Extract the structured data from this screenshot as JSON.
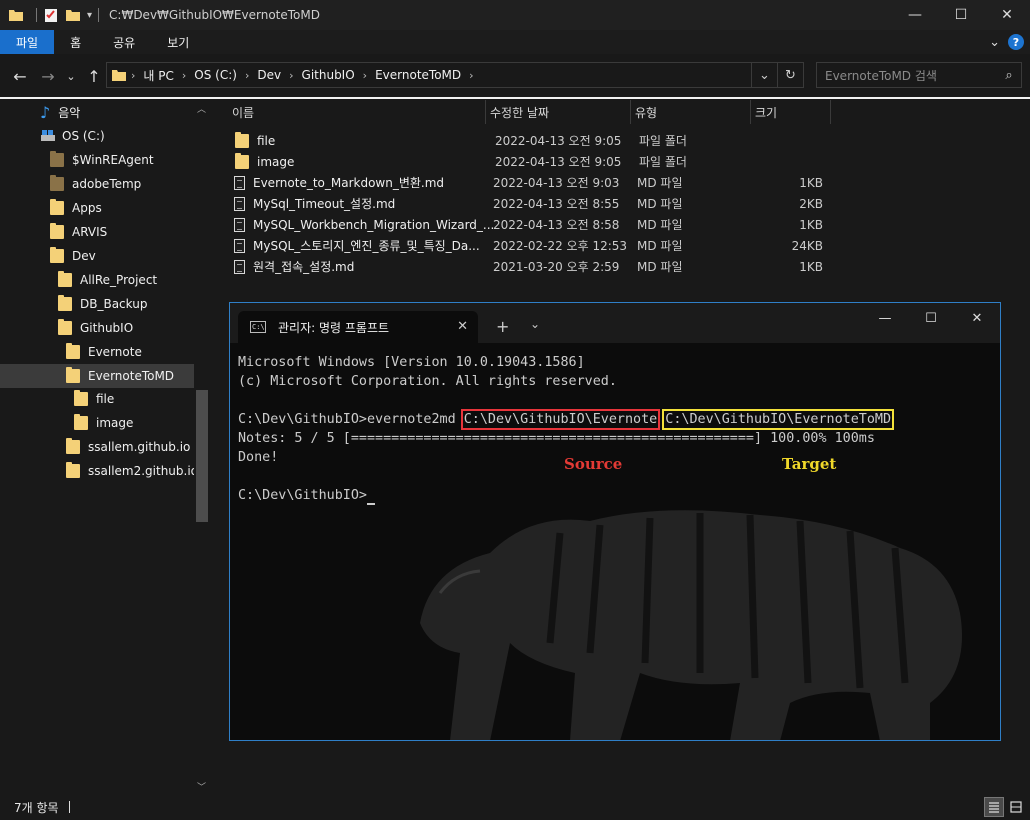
{
  "window": {
    "title_path": "C:₩Dev₩GithubIO₩EvernoteToMD",
    "controls": {
      "minimize": "—",
      "maximize": "☐",
      "close": "✕"
    }
  },
  "ribbon": {
    "tabs": [
      "파일",
      "홈",
      "공유",
      "보기"
    ],
    "active_tab": "파일",
    "help": "?",
    "expand": "⌄"
  },
  "nav": {
    "back": "←",
    "forward": "→",
    "recent": "⌄",
    "up": "↑",
    "breadcrumbs": [
      "내 PC",
      "OS (C:)",
      "Dev",
      "GithubIO",
      "EvernoteToMD"
    ],
    "dropdown": "⌄",
    "refresh": "↻",
    "search_placeholder": "EvernoteToMD 검색"
  },
  "sidebar": {
    "items": [
      {
        "label": "음악",
        "icon": "music-icon"
      },
      {
        "label": "OS (C:)",
        "icon": "drive-icon"
      },
      {
        "label": "$WinREAgent",
        "icon": "folder-icon",
        "dim": true
      },
      {
        "label": "adobeTemp",
        "icon": "folder-icon",
        "dim": true
      },
      {
        "label": "Apps",
        "icon": "folder-icon"
      },
      {
        "label": "ARVIS",
        "icon": "folder-icon"
      },
      {
        "label": "Dev",
        "icon": "folder-icon"
      },
      {
        "label": "AllRe_Project",
        "icon": "folder-icon"
      },
      {
        "label": "DB_Backup",
        "icon": "folder-icon"
      },
      {
        "label": "GithubIO",
        "icon": "folder-icon"
      },
      {
        "label": "Evernote",
        "icon": "folder-icon"
      },
      {
        "label": "EvernoteToMD",
        "icon": "folder-icon",
        "selected": true
      },
      {
        "label": "file",
        "icon": "folder-icon"
      },
      {
        "label": "image",
        "icon": "folder-icon"
      },
      {
        "label": "ssallem.github.io",
        "icon": "folder-icon"
      },
      {
        "label": "ssallem2.github.io",
        "icon": "folder-icon"
      }
    ]
  },
  "filelist": {
    "columns": [
      "이름",
      "수정한 날짜",
      "유형",
      "크기"
    ],
    "rows": [
      {
        "name": "file",
        "date": "2022-04-13 오전 9:05",
        "type": "파일 폴더",
        "size": "",
        "icon": "folder-icon"
      },
      {
        "name": "image",
        "date": "2022-04-13 오전 9:05",
        "type": "파일 폴더",
        "size": "",
        "icon": "folder-icon"
      },
      {
        "name": "Evernote_to_Markdown_변환.md",
        "date": "2022-04-13 오전 9:03",
        "type": "MD 파일",
        "size": "1KB",
        "icon": "document-icon"
      },
      {
        "name": "MySql_Timeout_설정.md",
        "date": "2022-04-13 오전 8:55",
        "type": "MD 파일",
        "size": "2KB",
        "icon": "document-icon"
      },
      {
        "name": "MySQL_Workbench_Migration_Wizard_...",
        "date": "2022-04-13 오전 8:58",
        "type": "MD 파일",
        "size": "1KB",
        "icon": "document-icon"
      },
      {
        "name": "MySQL_스토리지_엔진_종류_및_특징_Da...",
        "date": "2022-02-22 오후 12:53",
        "type": "MD 파일",
        "size": "24KB",
        "icon": "document-icon"
      },
      {
        "name": "원격_접속_설정.md",
        "date": "2021-03-20 오후 2:59",
        "type": "MD 파일",
        "size": "1KB",
        "icon": "document-icon"
      }
    ]
  },
  "terminal": {
    "tab_title": "관리자: 명령 프롬프트",
    "tab_close": "✕",
    "new_tab": "+",
    "dropdown": "⌄",
    "controls": {
      "minimize": "—",
      "maximize": "☐",
      "close": "✕"
    },
    "lines": {
      "l1": "Microsoft Windows [Version 10.0.19043.1586]",
      "l2": "(c) Microsoft Corporation. All rights reserved.",
      "cmd_prefix": "C:\\Dev\\GithubIO>evernote2md ",
      "source_path": "C:\\Dev\\GithubIO\\Evernote",
      "target_path": "C:\\Dev\\GithubIO\\EvernoteToMD",
      "progress": "Notes: 5 / 5 [==================================================] 100.00% 100ms",
      "done": "Done!",
      "prompt": "C:\\Dev\\GithubIO>"
    },
    "annotations": {
      "source": "Source",
      "target": "Target",
      "source_color": "#e33a35",
      "target_color": "#f0d82a"
    }
  },
  "status": {
    "item_count": "7개 항목"
  },
  "colors": {
    "accent": "#1a6fcc",
    "folder": "#f4d178",
    "terminal_border": "#2f7fc7"
  }
}
